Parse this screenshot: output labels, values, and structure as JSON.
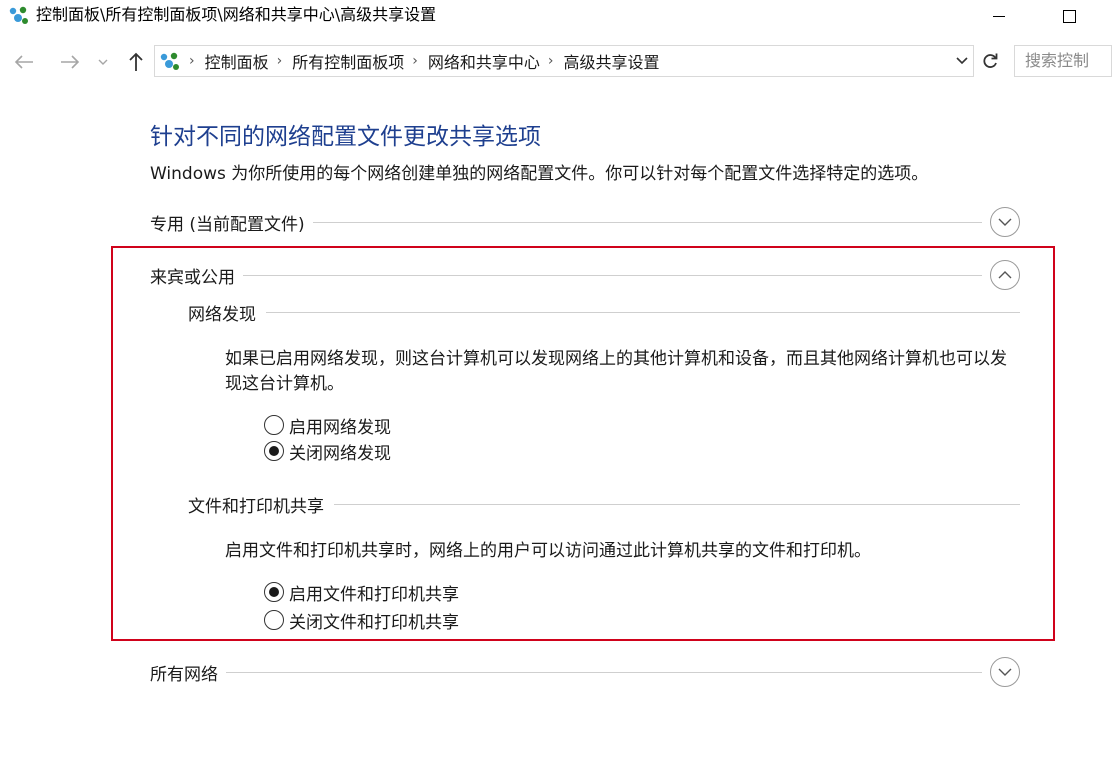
{
  "window": {
    "title": "控制面板\\所有控制面板项\\网络和共享中心\\高级共享设置"
  },
  "address": {
    "breadcrumbs": [
      "控制面板",
      "所有控制面板项",
      "网络和共享中心",
      "高级共享设置"
    ],
    "search_placeholder": "搜索控制"
  },
  "page": {
    "title": "针对不同的网络配置文件更改共享选项",
    "description": "Windows 为你所使用的每个网络创建单独的网络配置文件。你可以针对每个配置文件选择特定的选项。"
  },
  "profiles": {
    "private": {
      "label": "专用 (当前配置文件)",
      "expanded": false
    },
    "guest": {
      "label": "来宾或公用",
      "expanded": true,
      "network_discovery": {
        "heading": "网络发现",
        "description": "如果已启用网络发现，则这台计算机可以发现网络上的其他计算机和设备，而且其他网络计算机也可以发现这台计算机。",
        "options": [
          {
            "label": "启用网络发现",
            "checked": false
          },
          {
            "label": "关闭网络发现",
            "checked": true
          }
        ]
      },
      "file_printer_sharing": {
        "heading": "文件和打印机共享",
        "description": "启用文件和打印机共享时，网络上的用户可以访问通过此计算机共享的文件和打印机。",
        "options": [
          {
            "label": "启用文件和打印机共享",
            "checked": true
          },
          {
            "label": "关闭文件和打印机共享",
            "checked": false
          }
        ]
      }
    },
    "all": {
      "label": "所有网络",
      "expanded": false
    }
  },
  "colors": {
    "title_blue": "#1e3f8f",
    "highlight_red": "#d0021b"
  }
}
